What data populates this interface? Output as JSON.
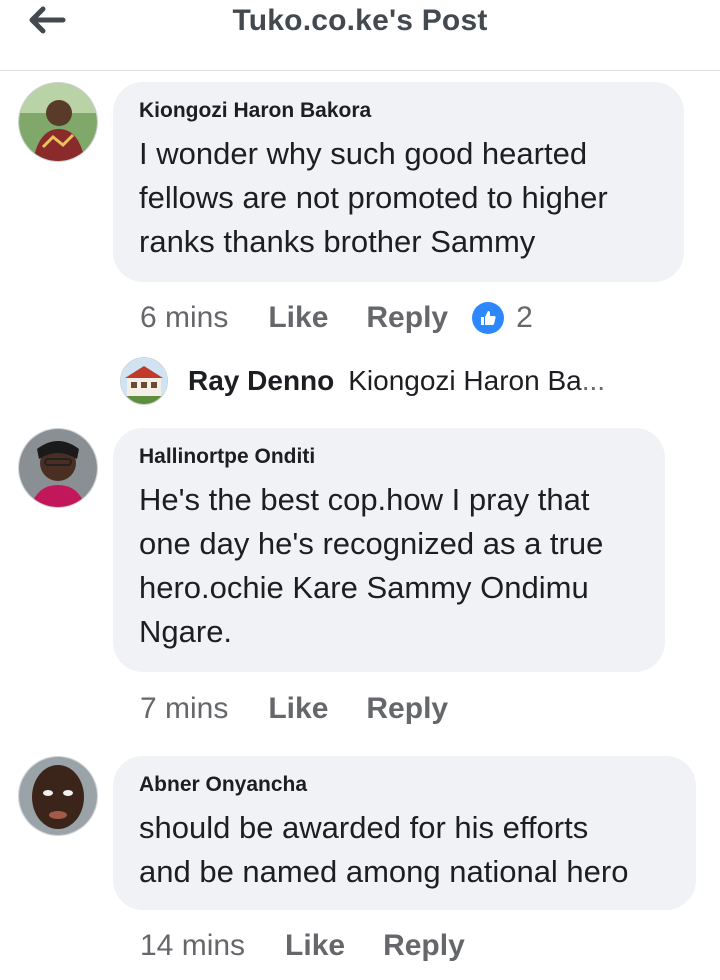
{
  "header": {
    "title": "Tuko.co.ke's Post",
    "back_icon": "arrow-left-icon"
  },
  "comments": [
    {
      "author": "Kiongozi Haron Bakora",
      "lines": [
        "I wonder why such good hearted",
        "fellows are not promoted to higher",
        "ranks thanks brother Sammy"
      ],
      "time": "6 mins",
      "like_label": "Like",
      "reply_label": "Reply",
      "reaction_icon": "like-reaction-icon",
      "reaction_count": "2"
    },
    {
      "author": "Hallinortpe Onditi",
      "lines": [
        "He's the best cop.how I pray that",
        "one day he's recognized as a true",
        "hero.ochie Kare Sammy Ondimu",
        "Ngare."
      ],
      "time": "7 mins",
      "like_label": "Like",
      "reply_label": "Reply"
    },
    {
      "author": "Abner Onyancha",
      "lines": [
        "should be awarded for his efforts",
        "and be named among national hero"
      ],
      "time": "14 mins",
      "like_label": "Like",
      "reply_label": "Reply"
    }
  ],
  "reply_preview": {
    "author": "Ray Denno",
    "text": "Kiongozi Haron Ba",
    "ellipsis": "..."
  },
  "colors": {
    "bubble": "#f0f2f5",
    "meta_text": "#65676b",
    "like_blue": "#2d88ff",
    "title_text": "#444950"
  }
}
